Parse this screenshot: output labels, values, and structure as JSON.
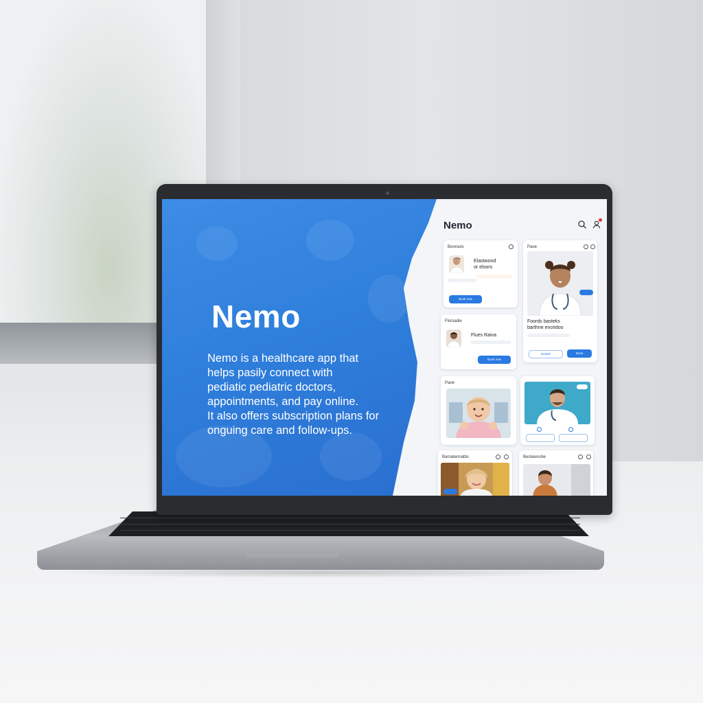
{
  "screen": {
    "hero": {
      "title": "Nemo",
      "description_lines": [
        "Nemo is a healthcare app that",
        "helps pasily connect with",
        "pediatic pediatric doctors,",
        "appointments, and pay online.",
        "It also offers subscription plans for",
        "onguing care and follow-ups."
      ]
    },
    "app": {
      "title": "Nemo",
      "icons": {
        "search": "search-icon",
        "profile": "profile-icon"
      },
      "cards": [
        {
          "label": "Booroois",
          "text": [
            "Elastwond",
            "or eloors"
          ],
          "button": "Book now"
        },
        {
          "label": "Paoe",
          "button": "Book"
        },
        {
          "label": "Florsadie",
          "text": [
            "Flues Raiva"
          ],
          "button": "Book now"
        },
        {
          "label": "",
          "text": [
            "Foords basteks",
            "barthrie encedoo"
          ],
          "button_outline": "Details",
          "button": "Book"
        },
        {
          "label": "Paoe"
        },
        {
          "label": "",
          "button": "Book"
        },
        {
          "label": "Barnatennatbs",
          "button": "Book"
        },
        {
          "label": "Bentaivosbe"
        }
      ]
    }
  },
  "colors": {
    "hero_blue": "#2f7fdc",
    "accent_blue": "#2a7ae2",
    "notification_red": "#e53935"
  }
}
